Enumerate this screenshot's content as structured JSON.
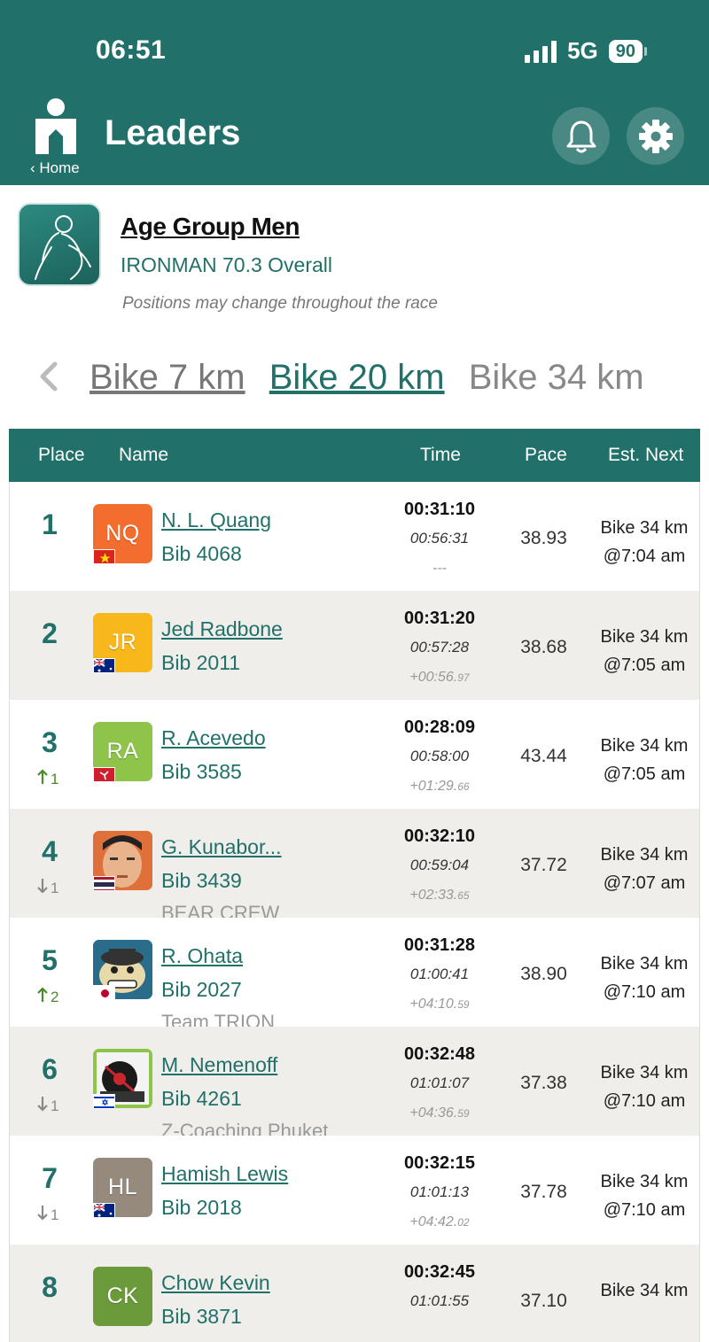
{
  "status_bar": {
    "time": "06:51",
    "network": "5G",
    "battery": "90"
  },
  "header": {
    "home_label": "Home",
    "title": "Leaders"
  },
  "group": {
    "title": "Age Group Men",
    "subtitle": "IRONMAN 70.3 Overall",
    "note": "Positions may change throughout the race"
  },
  "segments": [
    {
      "label": "Bike 7 km",
      "state": "past"
    },
    {
      "label": "Bike 20 km",
      "state": "active"
    },
    {
      "label": "Bike 34 km",
      "state": "next"
    }
  ],
  "table": {
    "headers": {
      "place": "Place",
      "name": "Name",
      "time": "Time",
      "pace": "Pace",
      "est_next": "Est. Next"
    },
    "rows": [
      {
        "place": "1",
        "delta": "",
        "delta_dir": "",
        "initials": "NQ",
        "avatar_color": "#f26d2e",
        "flag": "vn",
        "name": "N. L. Quang",
        "bib": "Bib 4068",
        "team": "",
        "time": "00:31:10",
        "split": "00:56:31",
        "gap": "---",
        "gap_small": "",
        "pace": "38.93",
        "est_seg": "Bike 34 km",
        "est_time": "@7:04 am"
      },
      {
        "place": "2",
        "delta": "",
        "delta_dir": "",
        "initials": "JR",
        "avatar_color": "#f8b71a",
        "flag": "au",
        "name": "Jed Radbone",
        "bib": "Bib 2011",
        "team": "",
        "time": "00:31:20",
        "split": "00:57:28",
        "gap": "+00:56.",
        "gap_small": "97",
        "pace": "38.68",
        "est_seg": "Bike 34 km",
        "est_time": "@7:05 am"
      },
      {
        "place": "3",
        "delta": "1",
        "delta_dir": "up",
        "initials": "RA",
        "avatar_color": "#8ec44a",
        "flag": "im",
        "name": "R. Acevedo",
        "bib": "Bib 3585",
        "team": "",
        "time": "00:28:09",
        "split": "00:58:00",
        "gap": "+01:29.",
        "gap_small": "66",
        "pace": "43.44",
        "est_seg": "Bike 34 km",
        "est_time": "@7:05 am"
      },
      {
        "place": "4",
        "delta": "1",
        "delta_dir": "down",
        "initials": "",
        "avatar_color": "#e0703a",
        "flag": "th",
        "name": "G. Kunabor...",
        "bib": "Bib 3439",
        "team": "BEAR CREW",
        "time": "00:32:10",
        "split": "00:59:04",
        "gap": "+02:33.",
        "gap_small": "65",
        "pace": "37.72",
        "est_seg": "Bike 34 km",
        "est_time": "@7:07 am"
      },
      {
        "place": "5",
        "delta": "2",
        "delta_dir": "up",
        "initials": "",
        "avatar_color": "#2a6d8a",
        "flag": "jp",
        "name": "R. Ohata",
        "bib": "Bib 2027",
        "team": "Team TRION",
        "time": "00:31:28",
        "split": "01:00:41",
        "gap": "+04:10.",
        "gap_small": "59",
        "pace": "38.90",
        "est_seg": "Bike 34 km",
        "est_time": "@7:10 am"
      },
      {
        "place": "6",
        "delta": "1",
        "delta_dir": "down",
        "initials": "",
        "avatar_color": "#8ec44a",
        "flag": "il",
        "name": "M. Nemenoff",
        "bib": "Bib 4261",
        "team": "Z-Coaching Phuket",
        "time": "00:32:48",
        "split": "01:01:07",
        "gap": "+04:36.",
        "gap_small": "59",
        "pace": "37.38",
        "est_seg": "Bike 34 km",
        "est_time": "@7:10 am"
      },
      {
        "place": "7",
        "delta": "1",
        "delta_dir": "down",
        "initials": "HL",
        "avatar_color": "#958a7c",
        "flag": "au",
        "name": "Hamish Lewis",
        "bib": "Bib 2018",
        "team": "",
        "time": "00:32:15",
        "split": "01:01:13",
        "gap": "+04:42.",
        "gap_small": "02",
        "pace": "37.78",
        "est_seg": "Bike 34 km",
        "est_time": "@7:10 am"
      },
      {
        "place": "8",
        "delta": "",
        "delta_dir": "",
        "initials": "CK",
        "avatar_color": "#6b9a3a",
        "flag": "",
        "name": "Chow Kevin",
        "bib": "Bib 3871",
        "team": "",
        "time": "00:32:45",
        "split": "01:01:55",
        "gap": "",
        "gap_small": "",
        "pace": "37.10",
        "est_seg": "Bike 34 km",
        "est_time": ""
      }
    ]
  }
}
